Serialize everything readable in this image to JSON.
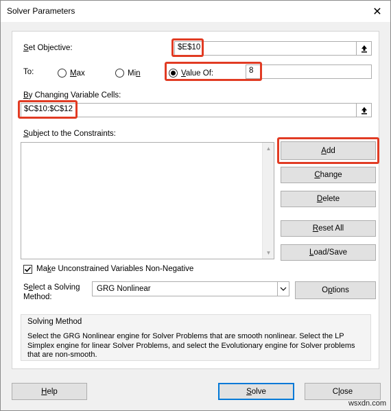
{
  "window": {
    "title": "Solver Parameters",
    "close_glyph": "✕"
  },
  "objective": {
    "label": "Set Objective:",
    "value": "$E$10"
  },
  "to": {
    "label": "To:",
    "options": [
      {
        "label": "Max",
        "selected": false
      },
      {
        "label": "Min",
        "selected": false
      },
      {
        "label": "Value Of:",
        "selected": true
      }
    ],
    "value_of": "8"
  },
  "changing_cells": {
    "label": "By Changing Variable Cells:",
    "value": "$C$10:$C$12"
  },
  "constraints": {
    "label": "Subject to the Constraints:",
    "items": [],
    "buttons": {
      "add": "Add",
      "change": "Change",
      "delete": "Delete",
      "reset_all": "Reset All",
      "load_save": "Load/Save"
    }
  },
  "non_negative": {
    "label": "Make Unconstrained Variables Non-Negative",
    "checked": true
  },
  "method": {
    "label_line1": "Select a Solving",
    "label_line2": "Method:",
    "selected": "GRG Nonlinear",
    "options_button": "Options"
  },
  "solving_method": {
    "title": "Solving Method",
    "description": "Select the GRG Nonlinear engine for Solver Problems that are smooth nonlinear. Select the LP Simplex engine for linear Solver Problems, and select the Evolutionary engine for Solver problems that are non-smooth."
  },
  "footer": {
    "help": "Help",
    "solve": "Solve",
    "close": "Close"
  },
  "watermark": "wsxdn.com",
  "colors": {
    "highlight": "#e13b23",
    "default_button_border": "#0078d7"
  },
  "icons": {
    "range_selector": "range-collapse-icon",
    "dropdown": "chevron-down-icon"
  }
}
